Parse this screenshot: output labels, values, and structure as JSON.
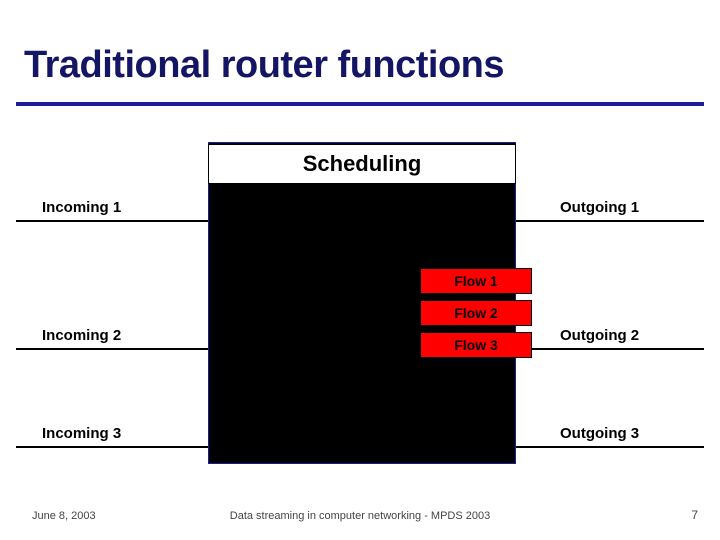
{
  "title": "Traditional router functions",
  "scheduling_label": "Scheduling",
  "ports": {
    "incoming": [
      "Incoming 1",
      "Incoming 2",
      "Incoming 3"
    ],
    "outgoing": [
      "Outgoing 1",
      "Outgoing 2",
      "Outgoing 3"
    ]
  },
  "flows": [
    "Flow 1",
    "Flow 2",
    "Flow 3"
  ],
  "footer": {
    "date": "June 8, 2003",
    "center": "Data streaming in computer networking - MPDS 2003",
    "page": "7"
  },
  "colors": {
    "title": "#151565",
    "rule": "#1d1d9b",
    "flow_fill": "#ff0000"
  }
}
